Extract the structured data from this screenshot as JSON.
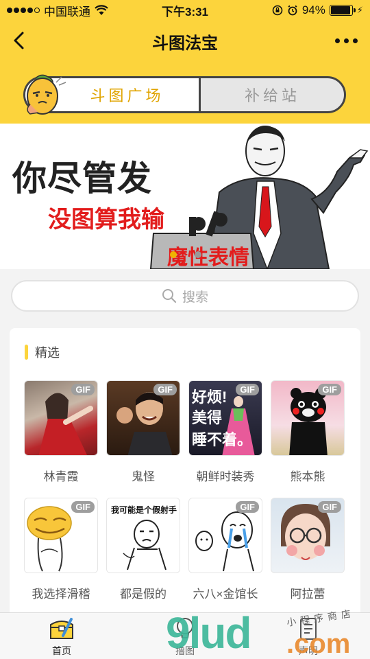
{
  "status": {
    "carrier": "中国联通",
    "time": "下午3:31",
    "battery": "94%"
  },
  "nav": {
    "title": "斗图法宝"
  },
  "tabs": [
    {
      "label": "斗图广场",
      "active": true
    },
    {
      "label": "补给站",
      "active": false
    }
  ],
  "banner": {
    "line1": "你尽管发",
    "line2": "没图算我输",
    "line3": "魔性表情",
    "slide_index": 1,
    "slide_count": 2
  },
  "search": {
    "placeholder": "搜索"
  },
  "section": {
    "title": "精选"
  },
  "items": [
    {
      "label": "林青霞",
      "badge": "GIF"
    },
    {
      "label": "鬼怪",
      "badge": "GIF"
    },
    {
      "label": "朝鲜时装秀",
      "badge": "GIF",
      "caption": [
        "好烦!",
        "美得",
        "睡不着。"
      ]
    },
    {
      "label": "熊本熊",
      "badge": "GIF"
    },
    {
      "label": "我选择滑稽",
      "badge": "GIF"
    },
    {
      "label": "都是假的",
      "badge": "",
      "caption": [
        "我可能是个假射手"
      ]
    },
    {
      "label": "六八×金馆长",
      "badge": "GIF"
    },
    {
      "label": "阿拉蕾",
      "badge": "GIF"
    }
  ],
  "tabbar": [
    {
      "label": "首页",
      "active": true
    },
    {
      "label": "撸图",
      "active": false
    },
    {
      "label": "声明",
      "active": false
    }
  ],
  "watermark": {
    "main": "9lud",
    "suffix": ".com",
    "small": "小程序商店"
  },
  "colors": {
    "brand_yellow": "#fcd43c",
    "accent_orange": "#e0a400",
    "banner_red": "#e21c1c"
  }
}
